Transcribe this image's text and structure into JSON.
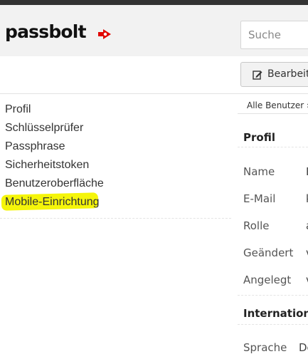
{
  "app": {
    "brand": "passbolt",
    "search_placeholder": "Suche"
  },
  "toolbar": {
    "edit_label": "Bearbeit"
  },
  "sidebar": {
    "items": [
      {
        "label": "Profil",
        "active": true
      },
      {
        "label": "Schlüsselprüfer",
        "active": false
      },
      {
        "label": "Passphrase",
        "active": false
      },
      {
        "label": "Sicherheitstoken",
        "active": false
      },
      {
        "label": "Benutzeroberfläche",
        "active": false
      },
      {
        "label": "Mobile-Einrichtung",
        "active": false,
        "highlighted": true
      }
    ]
  },
  "breadcrumb": "Alle Benutzer ›",
  "profile": {
    "title": "Profil",
    "fields": [
      {
        "label": "Name",
        "value": "E"
      },
      {
        "label": "E-Mail",
        "value": "k"
      },
      {
        "label": "Rolle",
        "value": "a"
      },
      {
        "label": "Geändert",
        "value": "v"
      },
      {
        "label": "Angelegt",
        "value": "v"
      }
    ]
  },
  "internationalisation": {
    "title": "Internation",
    "fields": [
      {
        "label": "Sprache",
        "value": "De"
      }
    ]
  },
  "colors": {
    "brand_red": "#e10600",
    "highlight_yellow": "#f5f50a",
    "header_bg": "#f2f2f2",
    "topbar": "#333333"
  }
}
